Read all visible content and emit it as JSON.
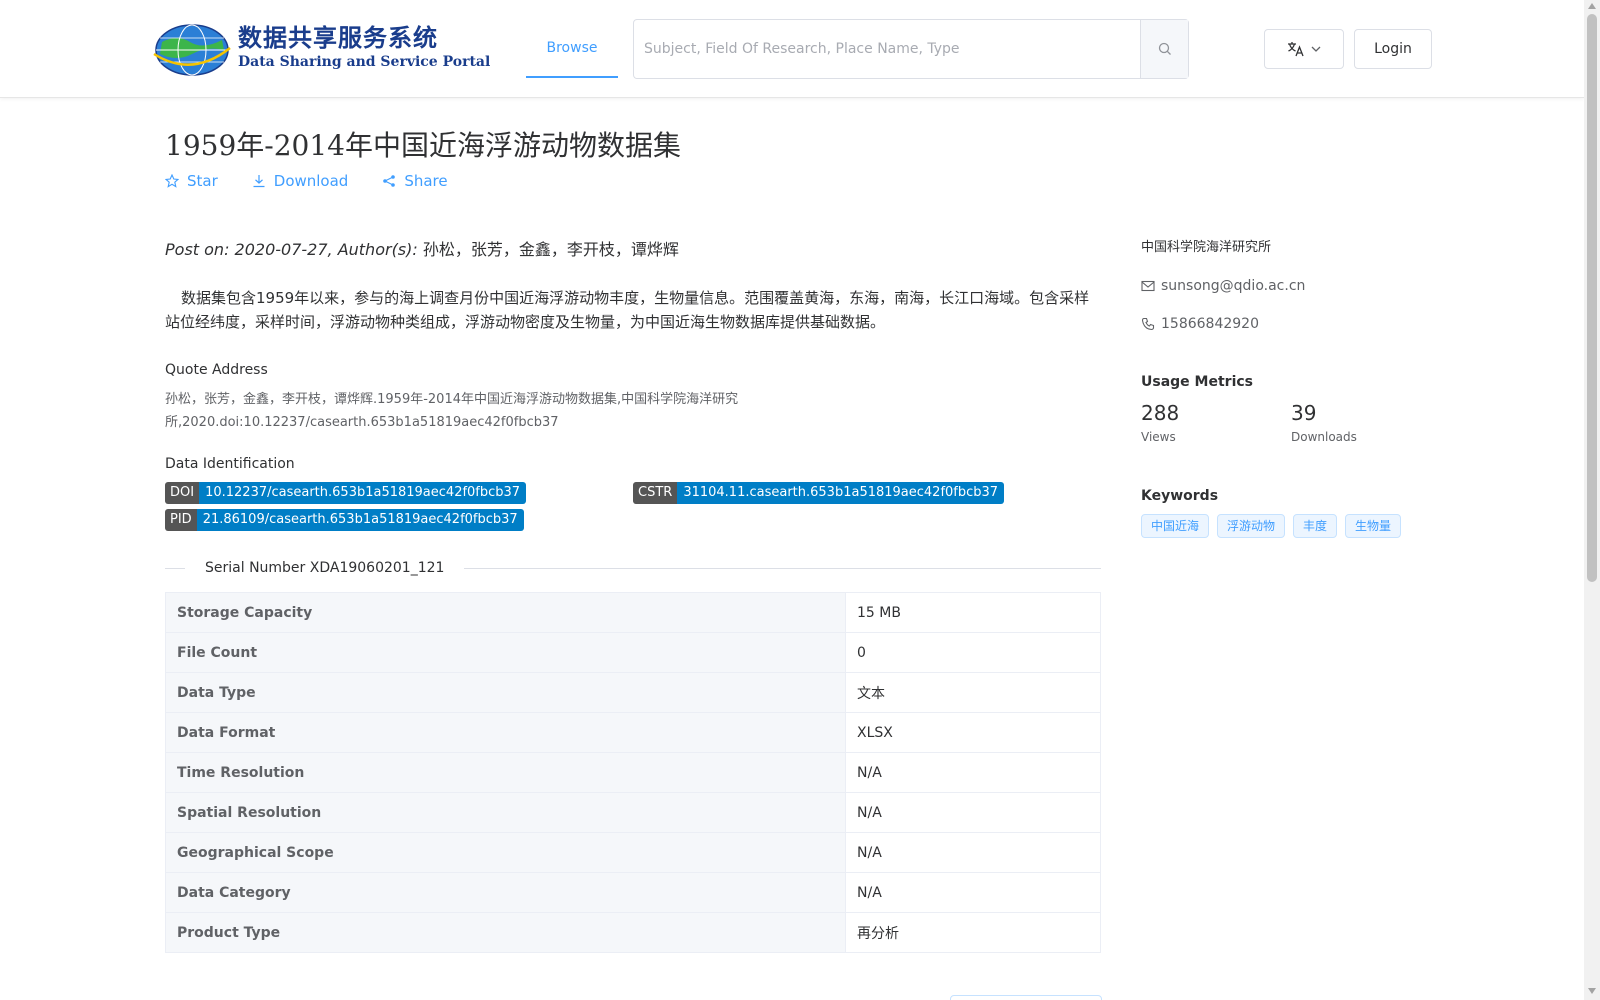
{
  "header": {
    "logo_cn": "数据共享服务系统",
    "logo_en": "Data Sharing and Service Portal",
    "nav_browse": "Browse",
    "search_placeholder": "Subject, Field Of Research, Place Name, Type",
    "login": "Login"
  },
  "dataset": {
    "title": "1959年-2014年中国近海浮游动物数据集",
    "actions": {
      "star": "Star",
      "download": "Download",
      "share": "Share"
    },
    "post_prefix": "Post on: 2020-07-27, Author(s):",
    "authors": "孙松，张芳，金鑫，李开枝，谭烨辉",
    "description": "数据集包含1959年以来，参与的海上调查月份中国近海浮游动物丰度，生物量信息。范围覆盖黄海，东海，南海，长江口海域。包含采样站位经纬度，采样时间，浮游动物种类组成，浮游动物密度及生物量，为中国近海生物数据库提供基础数据。",
    "quote_label": "Quote Address",
    "quote_text": "孙松，张芳，金鑫，李开枝，谭烨辉.1959年-2014年中国近海浮游动物数据集,中国科学院海洋研究所,2020.doi:10.12237/casearth.653b1a51819aec42f0fbcb37",
    "ident_label": "Data Identification",
    "badges": {
      "doi_key": "DOI",
      "doi_val": "10.12237/casearth.653b1a51819aec42f0fbcb37",
      "cstr_key": "CSTR",
      "cstr_val": "31104.11.casearth.653b1a51819aec42f0fbcb37",
      "pid_key": "PID",
      "pid_val": "21.86109/casearth.653b1a51819aec42f0fbcb37"
    },
    "serial": "Serial Number XDA19060201_121",
    "details": [
      {
        "key": "Storage Capacity",
        "value": "15 MB"
      },
      {
        "key": "File Count",
        "value": "0"
      },
      {
        "key": "Data Type",
        "value": "文本"
      },
      {
        "key": "Data Format",
        "value": "XLSX"
      },
      {
        "key": "Time Resolution",
        "value": "N/A"
      },
      {
        "key": "Spatial Resolution",
        "value": "N/A"
      },
      {
        "key": "Geographical Scope",
        "value": "N/A"
      },
      {
        "key": "Data Category",
        "value": "N/A"
      },
      {
        "key": "Product Type",
        "value": "再分析"
      }
    ]
  },
  "sidebar": {
    "organization": "中国科学院海洋研究所",
    "email": "sunsong@qdio.ac.cn",
    "phone": "15866842920",
    "metrics_title": "Usage Metrics",
    "views": "288",
    "views_label": "Views",
    "downloads": "39",
    "downloads_label": "Downloads",
    "keywords_title": "Keywords",
    "keywords": [
      "中国近海",
      "浮游动物",
      "丰度",
      "生物量"
    ]
  },
  "colors": {
    "accent": "#409eff",
    "badge_key": "#555555",
    "badge_value": "#007ec6",
    "logo": "#1a3d8c"
  }
}
